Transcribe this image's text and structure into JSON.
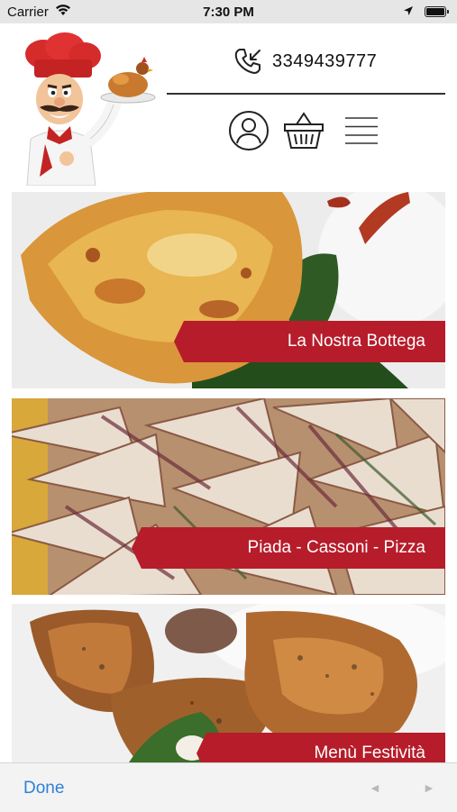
{
  "status_bar": {
    "carrier": "Carrier",
    "time": "7:30 PM"
  },
  "header": {
    "phone_number": "3349439777",
    "icons": [
      "chef-logo",
      "phone-callback-icon",
      "user-account-icon",
      "shopping-basket-icon",
      "menu-icon"
    ]
  },
  "cards": [
    {
      "label": "La Nostra Bottega"
    },
    {
      "label": "Piada - Cassoni - Pizza"
    },
    {
      "label": "Menù Festività"
    }
  ],
  "toolbar": {
    "done_label": "Done",
    "back_glyph": "◄",
    "forward_glyph": "►"
  },
  "colors": {
    "accent_red": "#b71c2a",
    "link_blue": "#2f80d8"
  }
}
